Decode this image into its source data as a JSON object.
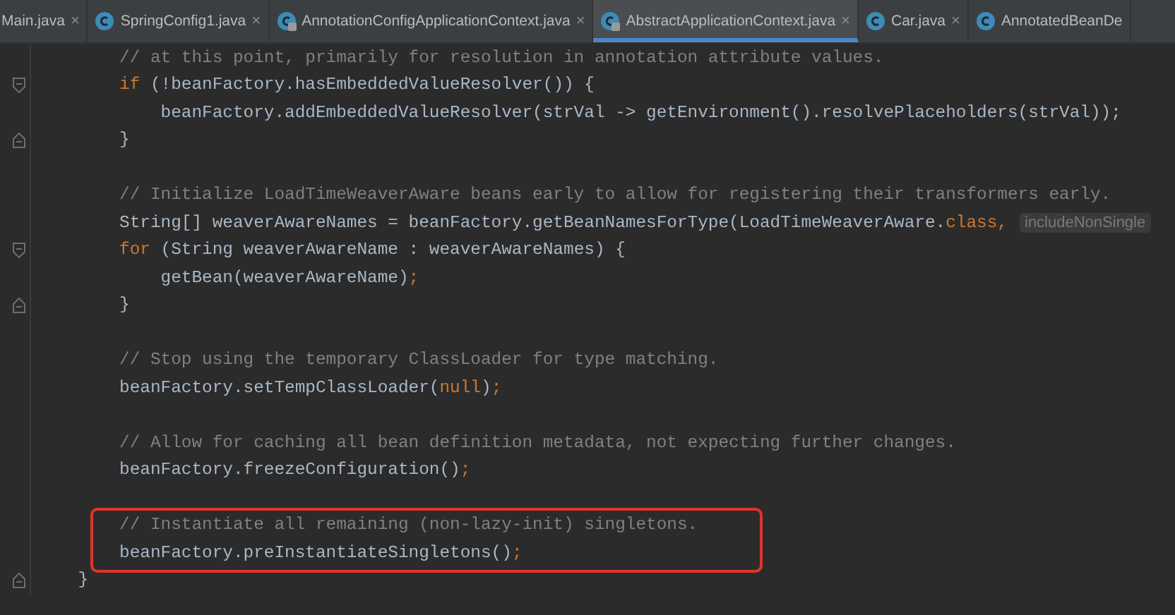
{
  "tabs": [
    {
      "label": "Main.java",
      "selected": false,
      "kind": "plain",
      "close": "×"
    },
    {
      "label": "SpringConfig1.java",
      "selected": false,
      "kind": "class",
      "locked": false,
      "close": "×"
    },
    {
      "label": "AnnotationConfigApplicationContext.java",
      "selected": false,
      "kind": "class",
      "locked": true,
      "close": "×"
    },
    {
      "label": "AbstractApplicationContext.java",
      "selected": true,
      "kind": "class",
      "locked": true,
      "close": "×"
    },
    {
      "label": "Car.java",
      "selected": false,
      "kind": "class",
      "locked": false,
      "close": "×"
    },
    {
      "label": "AnnotatedBeanDe",
      "selected": false,
      "kind": "class",
      "locked": false
    }
  ],
  "editor": {
    "blocks": [
      {
        "highlighted": false,
        "lines": [
          {
            "kind": "code",
            "tokens": [
              {
                "kind": "comment",
                "text": "        // at this point, primarily for resolution in annotation attribute values."
              }
            ]
          },
          {
            "kind": "fold-start",
            "tokens": [
              {
                "kind": "keyword",
                "text": "        if"
              },
              {
                "kind": "plain",
                "text": " (!beanFactory.hasEmbeddedValueResolver()) {"
              }
            ]
          },
          {
            "kind": "code",
            "tokens": [
              {
                "kind": "plain",
                "text": "            beanFactory.addEmbeddedValueResolver(strVal -> getEnvironment().resolvePlaceholders(strVal));"
              }
            ]
          },
          {
            "kind": "fold-end",
            "tokens": [
              {
                "kind": "plain",
                "text": "        }"
              }
            ]
          },
          {
            "kind": "blank"
          },
          {
            "kind": "code",
            "tokens": [
              {
                "kind": "comment",
                "text": "        // Initialize LoadTimeWeaverAware beans early to allow for registering their transformers early."
              }
            ]
          },
          {
            "kind": "code",
            "tokens": [
              {
                "kind": "plain",
                "text": "        String[] weaverAwareNames = beanFactory.getBeanNamesForType(LoadTimeWeaverAware."
              },
              {
                "kind": "keyword",
                "text": "class,"
              }
            ],
            "hint": "includeNonSingle"
          },
          {
            "kind": "fold-start",
            "tokens": [
              {
                "kind": "keyword",
                "text": "        for"
              },
              {
                "kind": "plain",
                "text": " (String weaverAwareName : weaverAwareNames) {"
              }
            ]
          },
          {
            "kind": "code",
            "tokens": [
              {
                "kind": "plain",
                "text": "            getBean(weaverAwareName)"
              },
              {
                "kind": "keyword",
                "text": ";"
              }
            ]
          },
          {
            "kind": "fold-end",
            "tokens": [
              {
                "kind": "plain",
                "text": "        }"
              }
            ]
          },
          {
            "kind": "blank"
          },
          {
            "kind": "code",
            "tokens": [
              {
                "kind": "comment",
                "text": "        // Stop using the temporary ClassLoader for type matching."
              }
            ]
          },
          {
            "kind": "code",
            "tokens": [
              {
                "kind": "plain",
                "text": "        beanFactory.setTempClassLoader("
              },
              {
                "kind": "keyword",
                "text": "null"
              },
              {
                "kind": "plain",
                "text": ")"
              },
              {
                "kind": "keyword",
                "text": ";"
              }
            ]
          },
          {
            "kind": "blank"
          },
          {
            "kind": "code",
            "tokens": [
              {
                "kind": "comment",
                "text": "        // Allow for caching all bean definition metadata, not expecting further changes."
              }
            ]
          },
          {
            "kind": "code",
            "tokens": [
              {
                "kind": "plain",
                "text": "        beanFactory.freezeConfiguration()"
              },
              {
                "kind": "keyword",
                "text": ";"
              }
            ]
          },
          {
            "kind": "blank"
          }
        ]
      },
      {
        "highlighted": true,
        "lines": [
          {
            "kind": "code",
            "tokens": [
              {
                "kind": "comment",
                "text": "        // Instantiate all remaining (non-lazy-init) singletons."
              }
            ]
          },
          {
            "kind": "code",
            "tokens": [
              {
                "kind": "plain",
                "text": "        beanFactory.preInstantiateSingletons()"
              },
              {
                "kind": "keyword",
                "text": ";"
              }
            ]
          }
        ]
      },
      {
        "highlighted": false,
        "lines": [
          {
            "kind": "fold-end",
            "tokens": [
              {
                "kind": "plain",
                "text": "    }"
              }
            ]
          }
        ]
      }
    ]
  }
}
